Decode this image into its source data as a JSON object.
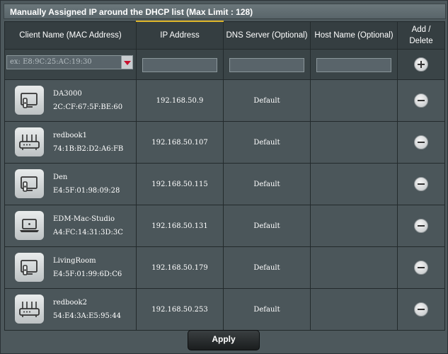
{
  "title": "Manually Assigned IP around the DHCP list (Max Limit : 128)",
  "columns": {
    "client": "Client Name (MAC Address)",
    "ip": "IP Address",
    "dns": "DNS Server (Optional)",
    "host": "Host Name (Optional)",
    "action_line1": "Add /",
    "action_line2": "Delete"
  },
  "entry": {
    "client_placeholder": "ex: E8:9C:25:AC:19:30",
    "ip_value": "",
    "dns_value": "",
    "host_value": ""
  },
  "rows": [
    {
      "name": "DA3000",
      "mac": "2C:CF:67:5F:BE:60",
      "ip": "192.168.50.9",
      "dns": "Default",
      "host": "",
      "icon": "media-device-icon"
    },
    {
      "name": "redbook1",
      "mac": "74:1B:B2:D2:A6:FB",
      "ip": "192.168.50.107",
      "dns": "Default",
      "host": "",
      "icon": "router-icon"
    },
    {
      "name": "Den",
      "mac": "E4:5F:01:98:09:28",
      "ip": "192.168.50.115",
      "dns": "Default",
      "host": "",
      "icon": "media-device-icon"
    },
    {
      "name": "EDM-Mac-Studio",
      "mac": "A4:FC:14:31:3D:3C",
      "ip": "192.168.50.131",
      "dns": "Default",
      "host": "",
      "icon": "laptop-icon"
    },
    {
      "name": "LivingRoom",
      "mac": "E4:5F:01:99:6D:C6",
      "ip": "192.168.50.179",
      "dns": "Default",
      "host": "",
      "icon": "media-device-icon"
    },
    {
      "name": "redbook2",
      "mac": "54:E4:3A:E5:95:44",
      "ip": "192.168.50.253",
      "dns": "Default",
      "host": "",
      "icon": "router-icon"
    }
  ],
  "apply_label": "Apply"
}
